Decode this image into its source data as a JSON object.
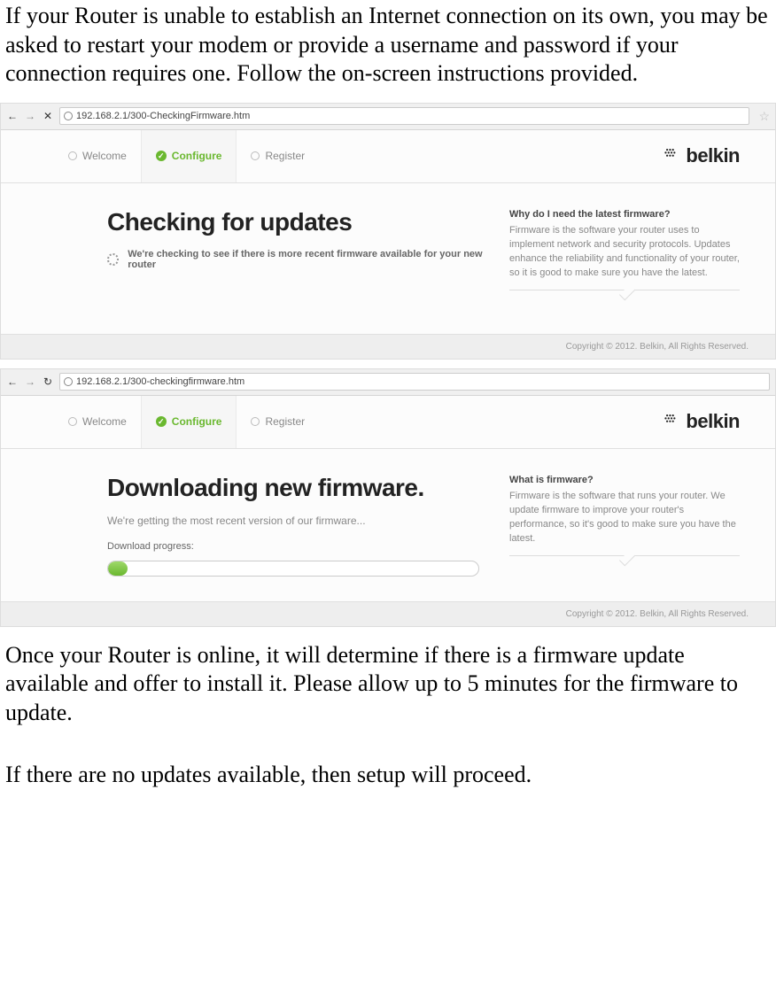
{
  "intro_text": "If your Router is unable to establish an Internet connection on its own, you may be asked to restart your modem or provide a username and password if your connection requires one. Follow the on-screen instructions provided.",
  "screenshot1": {
    "url": "192.168.2.1/300-CheckingFirmware.htm",
    "steps": {
      "welcome": "Welcome",
      "configure": "Configure",
      "register": "Register"
    },
    "logo_text": "belkin",
    "heading": "Checking for updates",
    "status": "We're checking to see if there is more recent firmware available for your new router",
    "side_title": "Why do I need the latest firmware?",
    "side_body": "Firmware is the software your router uses to implement network and security protocols. Updates enhance the reliability and functionality of your router, so it is good to make sure you have the latest.",
    "copyright": "Copyright © 2012. Belkin, All Rights Reserved."
  },
  "screenshot2": {
    "url": "192.168.2.1/300-checkingfirmware.htm",
    "steps": {
      "welcome": "Welcome",
      "configure": "Configure",
      "register": "Register"
    },
    "logo_text": "belkin",
    "heading": "Downloading new firmware.",
    "sub": "We're getting the most recent version of our firmware...",
    "progress_label": "Download progress:",
    "side_title": "What is firmware?",
    "side_body": "Firmware is the software that runs your router. We update firmware to improve your router's performance, so it's good to make sure you have the latest.",
    "copyright": "Copyright © 2012. Belkin, All Rights Reserved."
  },
  "outro1": "Once your Router is online, it will determine if there is a firmware update available and offer to install it. Please allow up to 5 minutes for the firmware to update.",
  "outro2": "If there are no updates available, then setup will proceed."
}
